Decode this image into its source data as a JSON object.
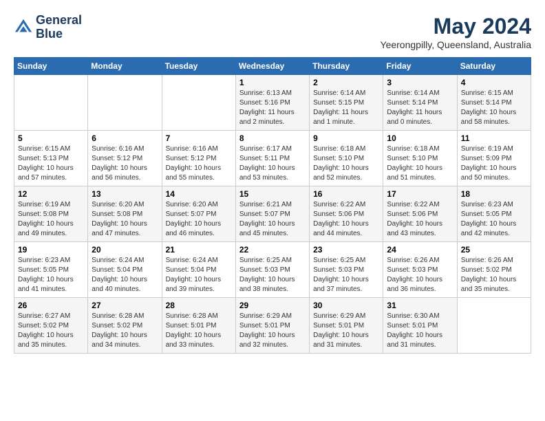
{
  "header": {
    "logo_line1": "General",
    "logo_line2": "Blue",
    "month_year": "May 2024",
    "location": "Yeerongpilly, Queensland, Australia"
  },
  "weekdays": [
    "Sunday",
    "Monday",
    "Tuesday",
    "Wednesday",
    "Thursday",
    "Friday",
    "Saturday"
  ],
  "weeks": [
    [
      {
        "day": "",
        "info": ""
      },
      {
        "day": "",
        "info": ""
      },
      {
        "day": "",
        "info": ""
      },
      {
        "day": "1",
        "info": "Sunrise: 6:13 AM\nSunset: 5:16 PM\nDaylight: 11 hours\nand 2 minutes."
      },
      {
        "day": "2",
        "info": "Sunrise: 6:14 AM\nSunset: 5:15 PM\nDaylight: 11 hours\nand 1 minute."
      },
      {
        "day": "3",
        "info": "Sunrise: 6:14 AM\nSunset: 5:14 PM\nDaylight: 11 hours\nand 0 minutes."
      },
      {
        "day": "4",
        "info": "Sunrise: 6:15 AM\nSunset: 5:14 PM\nDaylight: 10 hours\nand 58 minutes."
      }
    ],
    [
      {
        "day": "5",
        "info": "Sunrise: 6:15 AM\nSunset: 5:13 PM\nDaylight: 10 hours\nand 57 minutes."
      },
      {
        "day": "6",
        "info": "Sunrise: 6:16 AM\nSunset: 5:12 PM\nDaylight: 10 hours\nand 56 minutes."
      },
      {
        "day": "7",
        "info": "Sunrise: 6:16 AM\nSunset: 5:12 PM\nDaylight: 10 hours\nand 55 minutes."
      },
      {
        "day": "8",
        "info": "Sunrise: 6:17 AM\nSunset: 5:11 PM\nDaylight: 10 hours\nand 53 minutes."
      },
      {
        "day": "9",
        "info": "Sunrise: 6:18 AM\nSunset: 5:10 PM\nDaylight: 10 hours\nand 52 minutes."
      },
      {
        "day": "10",
        "info": "Sunrise: 6:18 AM\nSunset: 5:10 PM\nDaylight: 10 hours\nand 51 minutes."
      },
      {
        "day": "11",
        "info": "Sunrise: 6:19 AM\nSunset: 5:09 PM\nDaylight: 10 hours\nand 50 minutes."
      }
    ],
    [
      {
        "day": "12",
        "info": "Sunrise: 6:19 AM\nSunset: 5:08 PM\nDaylight: 10 hours\nand 49 minutes."
      },
      {
        "day": "13",
        "info": "Sunrise: 6:20 AM\nSunset: 5:08 PM\nDaylight: 10 hours\nand 47 minutes."
      },
      {
        "day": "14",
        "info": "Sunrise: 6:20 AM\nSunset: 5:07 PM\nDaylight: 10 hours\nand 46 minutes."
      },
      {
        "day": "15",
        "info": "Sunrise: 6:21 AM\nSunset: 5:07 PM\nDaylight: 10 hours\nand 45 minutes."
      },
      {
        "day": "16",
        "info": "Sunrise: 6:22 AM\nSunset: 5:06 PM\nDaylight: 10 hours\nand 44 minutes."
      },
      {
        "day": "17",
        "info": "Sunrise: 6:22 AM\nSunset: 5:06 PM\nDaylight: 10 hours\nand 43 minutes."
      },
      {
        "day": "18",
        "info": "Sunrise: 6:23 AM\nSunset: 5:05 PM\nDaylight: 10 hours\nand 42 minutes."
      }
    ],
    [
      {
        "day": "19",
        "info": "Sunrise: 6:23 AM\nSunset: 5:05 PM\nDaylight: 10 hours\nand 41 minutes."
      },
      {
        "day": "20",
        "info": "Sunrise: 6:24 AM\nSunset: 5:04 PM\nDaylight: 10 hours\nand 40 minutes."
      },
      {
        "day": "21",
        "info": "Sunrise: 6:24 AM\nSunset: 5:04 PM\nDaylight: 10 hours\nand 39 minutes."
      },
      {
        "day": "22",
        "info": "Sunrise: 6:25 AM\nSunset: 5:03 PM\nDaylight: 10 hours\nand 38 minutes."
      },
      {
        "day": "23",
        "info": "Sunrise: 6:25 AM\nSunset: 5:03 PM\nDaylight: 10 hours\nand 37 minutes."
      },
      {
        "day": "24",
        "info": "Sunrise: 6:26 AM\nSunset: 5:03 PM\nDaylight: 10 hours\nand 36 minutes."
      },
      {
        "day": "25",
        "info": "Sunrise: 6:26 AM\nSunset: 5:02 PM\nDaylight: 10 hours\nand 35 minutes."
      }
    ],
    [
      {
        "day": "26",
        "info": "Sunrise: 6:27 AM\nSunset: 5:02 PM\nDaylight: 10 hours\nand 35 minutes."
      },
      {
        "day": "27",
        "info": "Sunrise: 6:28 AM\nSunset: 5:02 PM\nDaylight: 10 hours\nand 34 minutes."
      },
      {
        "day": "28",
        "info": "Sunrise: 6:28 AM\nSunset: 5:01 PM\nDaylight: 10 hours\nand 33 minutes."
      },
      {
        "day": "29",
        "info": "Sunrise: 6:29 AM\nSunset: 5:01 PM\nDaylight: 10 hours\nand 32 minutes."
      },
      {
        "day": "30",
        "info": "Sunrise: 6:29 AM\nSunset: 5:01 PM\nDaylight: 10 hours\nand 31 minutes."
      },
      {
        "day": "31",
        "info": "Sunrise: 6:30 AM\nSunset: 5:01 PM\nDaylight: 10 hours\nand 31 minutes."
      },
      {
        "day": "",
        "info": ""
      }
    ]
  ]
}
